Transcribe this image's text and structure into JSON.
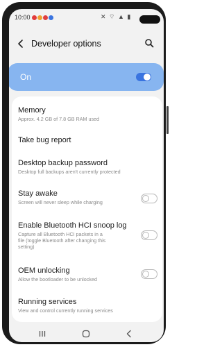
{
  "status_bar": {
    "time": "10:00",
    "app_icons": [
      "#e23b3b",
      "#f0a030",
      "#e04040",
      "#3a74e0"
    ],
    "system_icons_text": "✕ ⌔ ▲ ▮"
  },
  "header": {
    "title": "Developer options",
    "back_icon": "back-arrow-icon",
    "search_icon": "search-icon"
  },
  "master_switch": {
    "label": "On",
    "on": true,
    "accent": "#3a74e0",
    "row_color": "#87b5f0"
  },
  "items": [
    {
      "title": "Memory",
      "subtitle": "Approx. 4.2 GB of 7.8 GB RAM used",
      "has_toggle": false
    },
    {
      "title": "Take bug report",
      "subtitle": "",
      "has_toggle": false
    },
    {
      "title": "Desktop backup password",
      "subtitle": "Desktop full backups aren't currently protected",
      "has_toggle": false
    },
    {
      "title": "Stay awake",
      "subtitle": "Screen will never sleep while charging",
      "has_toggle": true,
      "on": false
    },
    {
      "title": "Enable Bluetooth HCI snoop log",
      "subtitle_lines": [
        "Capture all Bluetooth HCI packets in a",
        "file (toggle Bluetooth after changing this",
        "setting)"
      ],
      "has_toggle": true,
      "on": false
    },
    {
      "title": "OEM unlocking",
      "subtitle": "Allow the bootloader to be unlocked",
      "has_toggle": true,
      "on": false
    },
    {
      "title": "Running services",
      "subtitle": "View and control currently running services",
      "has_toggle": false
    }
  ],
  "nav_bar": {
    "recent": "recent-apps-icon",
    "home": "home-icon",
    "back": "back-nav-icon"
  }
}
